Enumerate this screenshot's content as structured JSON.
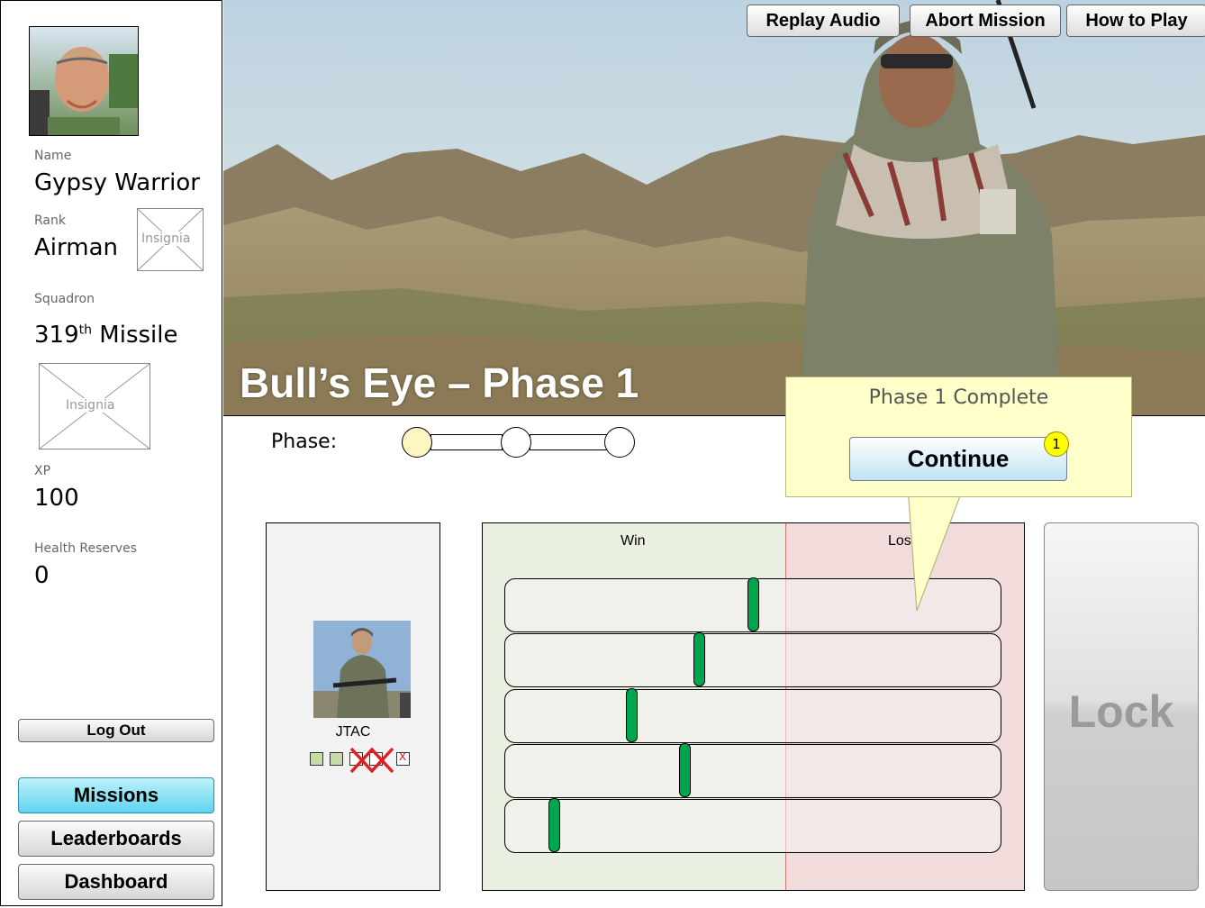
{
  "profile": {
    "name_label": "Name",
    "name": "Gypsy Warrior",
    "rank_label": "Rank",
    "rank": "Airman",
    "rank_insignia": "Insignia",
    "squadron_label": "Squadron",
    "squadron_number": "319",
    "squadron_suffix": "th",
    "squadron_name": "Missile",
    "squadron_insignia": "Insignia",
    "xp_label": "XP",
    "xp": "100",
    "health_label": "Health Reserves",
    "health": "0"
  },
  "sidebar_buttons": {
    "logout": "Log Out",
    "missions": "Missions",
    "leaderboards": "Leaderboards",
    "dashboard": "Dashboard"
  },
  "toolbar": {
    "replay_audio": "Replay Audio",
    "abort_mission": "Abort Mission",
    "how_to_play": "How to Play"
  },
  "mission": {
    "title": "Bull’s Eye – Phase 1",
    "phase_label": "Phase:",
    "phase_total": 3,
    "phase_current": 1
  },
  "callout": {
    "title": "Phase 1 Complete",
    "button": "Continue",
    "badge": "1"
  },
  "unit": {
    "name": "JTAC",
    "health_boxes": [
      "full",
      "full",
      "lost",
      "lost",
      "lost"
    ],
    "lost_mark": "X"
  },
  "outcome": {
    "win_label": "Win",
    "loss_label": "Loss",
    "marker_positions": [
      0.5,
      0.39,
      0.25,
      0.36,
      0.09
    ]
  },
  "lock_button": "Lock",
  "colors": {
    "missions_active": "#5fd4ee",
    "marker_green": "#00a64e",
    "win_zone": "#eaf0e1",
    "loss_zone": "#f2dcdb",
    "callout_bg": "#ffffc9",
    "badge": "#ffff00"
  }
}
